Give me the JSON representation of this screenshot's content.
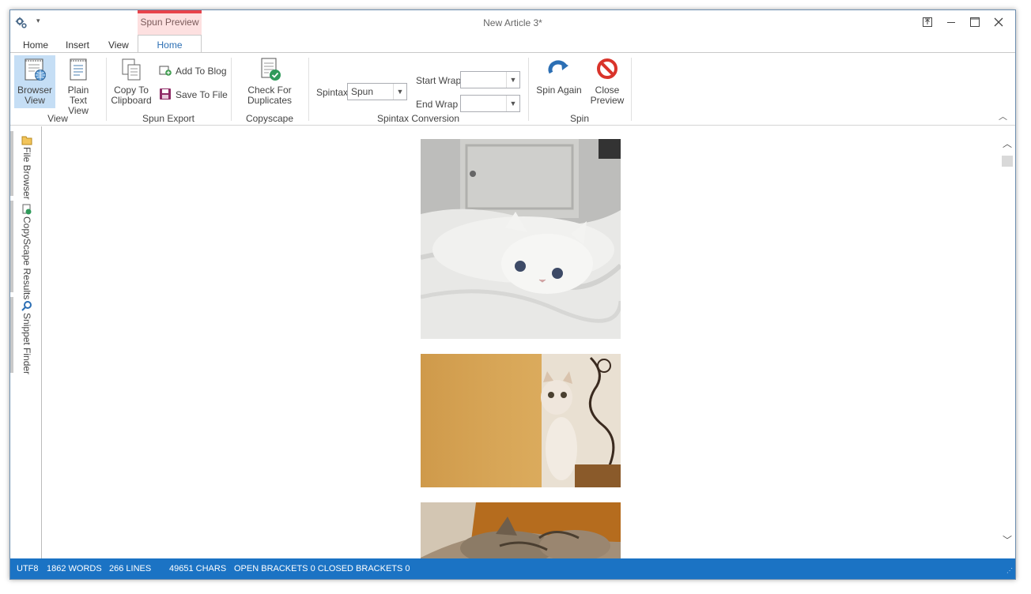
{
  "window": {
    "title": "New Article 3*"
  },
  "context_group": {
    "label": "Spun Preview",
    "color": "#e8434b",
    "bg": "#fde0e0"
  },
  "tabs": [
    {
      "label": "Home"
    },
    {
      "label": "Insert"
    },
    {
      "label": "View"
    },
    {
      "label": "Home",
      "active": true
    }
  ],
  "ribbon": {
    "groups": {
      "view": "View",
      "spun_export": "Spun Export",
      "copyscape": "Copyscape",
      "spintax_conversion": "Spintax Conversion",
      "spin": "Spin"
    },
    "browser_view": "Browser View",
    "plain_text_view": "Plain Text View",
    "copy_to_clipboard": "Copy To Clipboard",
    "add_to_blog": "Add To Blog",
    "save_to_file": "Save To File",
    "check_duplicates": "Check For Duplicates",
    "spintax_label": "Spintax",
    "spintax_value": "Spun",
    "start_wrap_label": "Start Wrap",
    "end_wrap_label": "End Wrap",
    "spin_again": "Spin Again",
    "close_preview": "Close Preview"
  },
  "side_panels": [
    "File Browser",
    "CopyScape Results",
    "Snippet Finder"
  ],
  "status": {
    "encoding": "UTF8",
    "words": "1862 WORDS",
    "lines": "266 LINES",
    "chars": "49651 CHARS",
    "brackets": "OPEN BRACKETS 0 CLOSED BRACKETS 0",
    "bg": "#1b73c4"
  },
  "icons": {
    "gear": "gear-icon",
    "browser_view": "browser-view-icon",
    "plain_text": "document-icon",
    "copy": "copy-icon",
    "add_to_blog": "add-blog-icon",
    "save": "save-icon",
    "check": "check-duplicates-icon",
    "spin_again": "refresh-icon",
    "close": "close-preview-icon"
  }
}
